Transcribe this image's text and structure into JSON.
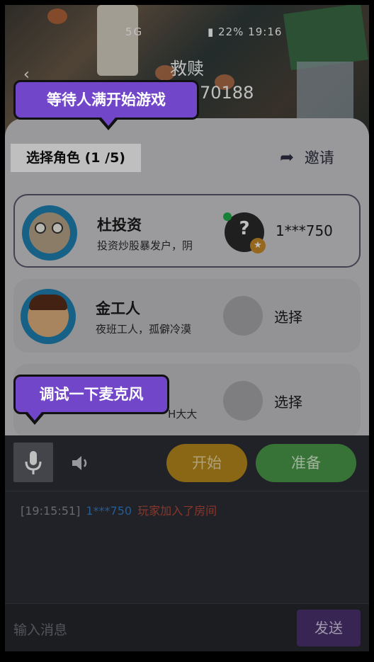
{
  "status_bar": {
    "left": "5G",
    "battery": "22%",
    "time": "19:16"
  },
  "room": {
    "title": "救赎",
    "id": "70188"
  },
  "tooltips": {
    "wait": "等待人满开始游戏",
    "mic": "调试一下麦克风"
  },
  "panel": {
    "select_label": "选择角色 (1 /5)",
    "invite_label": "邀请"
  },
  "roles": [
    {
      "name": "杜投资",
      "desc": "投资炒股暴发户，阴",
      "slot_text": "1***750",
      "selected": true
    },
    {
      "name": "金工人",
      "desc": "夜班工人，孤僻冷漠",
      "slot_text": "选择",
      "selected": false
    },
    {
      "name": "",
      "desc": "H大大",
      "slot_text": "选择",
      "selected": false
    }
  ],
  "controls": {
    "start_label": "开始",
    "ready_label": "准备"
  },
  "chat": {
    "time": "[19:15:51]",
    "user": "1***750",
    "message": "玩家加入了房间"
  },
  "input": {
    "placeholder": "输入消息",
    "send_label": "发送"
  },
  "colors": {
    "accent": "#7146c9",
    "start": "#b98a1c",
    "ready": "#4a9a4a",
    "send": "#4b3270"
  }
}
